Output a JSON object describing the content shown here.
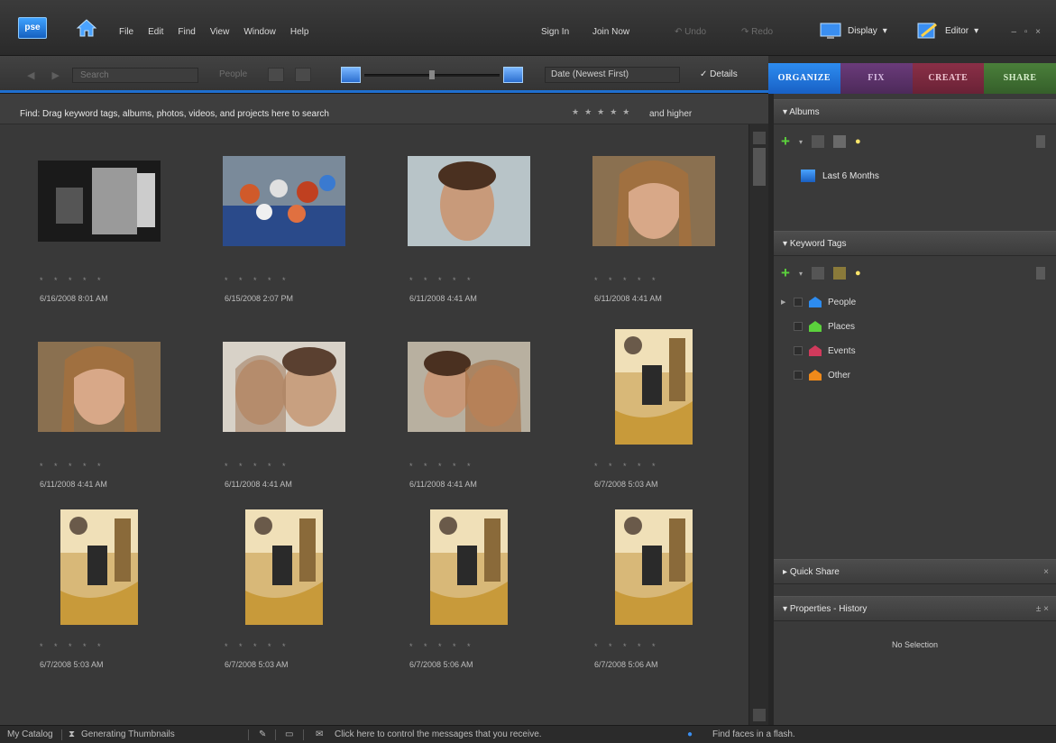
{
  "app": {
    "logo_text": "pse",
    "menu": [
      "File",
      "Edit",
      "Find",
      "View",
      "Window",
      "Help"
    ],
    "sign_in": "Sign In",
    "join_now": "Join Now",
    "undo": "Undo",
    "redo": "Redo",
    "display": "Display",
    "editor": "Editor",
    "window_controls": "– ▫ ×"
  },
  "toolbar": {
    "search_placeholder": "Search",
    "people": "People",
    "sort": "Date (Newest First)",
    "details": "✓ Details"
  },
  "tabs": [
    {
      "label": "ORGANIZE"
    },
    {
      "label": "FIX"
    },
    {
      "label": "CREATE"
    },
    {
      "label": "SHARE"
    }
  ],
  "find_bar": {
    "text": "Find: Drag keyword tags, albums, photos, videos, and projects here to search",
    "stars": "★★★★★",
    "and_higher": "and higher"
  },
  "photos": [
    {
      "date": "6/16/2008 8:01 AM",
      "stars": "* * * * *",
      "kind": "bw"
    },
    {
      "date": "6/15/2008 2:07 PM",
      "stars": "* * * * *",
      "kind": "balls"
    },
    {
      "date": "6/11/2008 4:41 AM",
      "stars": "* * * * *",
      "kind": "boy"
    },
    {
      "date": "6/11/2008 4:41 AM",
      "stars": "* * * * *",
      "kind": "girl"
    },
    {
      "date": "6/11/2008 4:41 AM",
      "stars": "* * * * *",
      "kind": "girl"
    },
    {
      "date": "6/11/2008 4:41 AM",
      "stars": "* * * * *",
      "kind": "couple"
    },
    {
      "date": "6/11/2008 4:41 AM",
      "stars": "* * * * *",
      "kind": "couple2"
    },
    {
      "date": "6/7/2008 5:03 AM",
      "stars": "* * * * *",
      "kind": "room"
    },
    {
      "date": "6/7/2008 5:03 AM",
      "stars": "* * * * *",
      "kind": "room"
    },
    {
      "date": "6/7/2008 5:03 AM",
      "stars": "* * * * *",
      "kind": "room"
    },
    {
      "date": "6/7/2008 5:06 AM",
      "stars": "* * * * *",
      "kind": "room"
    },
    {
      "date": "6/7/2008 5:06 AM",
      "stars": "* * * * *",
      "kind": "room"
    }
  ],
  "panel": {
    "albums_header": "Albums",
    "album_item": "Last 6 Months",
    "keyword_header": "Keyword Tags",
    "tags": [
      {
        "label": "People",
        "color": "#2d8cf0"
      },
      {
        "label": "Places",
        "color": "#5bd13c"
      },
      {
        "label": "Events",
        "color": "#d03a5c"
      },
      {
        "label": "Other",
        "color": "#f08a1a"
      }
    ],
    "quick_share": "Quick Share",
    "properties": "Properties - History",
    "no_selection": "No Selection"
  },
  "status": {
    "catalog": "My Catalog",
    "generating": "Generating Thumbnails",
    "messages": "Click here to control the messages that you receive.",
    "find_faces": "Find faces in a flash."
  },
  "colors": {
    "accent": "#1e6fd0",
    "organize": "#2d8cf0",
    "fix": "#6a3b7a",
    "create": "#8a2f47",
    "share": "#4a7f3a"
  }
}
